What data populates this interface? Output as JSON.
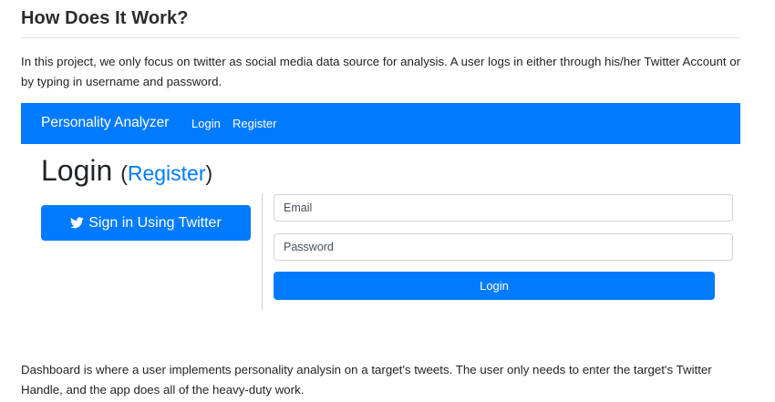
{
  "section": {
    "title": "How Does It Work?"
  },
  "intro": {
    "text": "In this project, we only focus on twitter as social media data source for analysis. A user logs in either through his/her Twitter Account or by typing in username and password."
  },
  "navbar": {
    "brand": "Personality Analyzer",
    "links": [
      "Login",
      "Register"
    ],
    "color": "#007bff"
  },
  "login_page": {
    "heading": "Login",
    "paren_open": "(",
    "register_link": "Register",
    "paren_close": ")",
    "twitter_button": {
      "label": "Sign in Using Twitter",
      "icon": "twitter-bird-icon"
    },
    "email": {
      "placeholder": "Email",
      "value": ""
    },
    "password": {
      "placeholder": "Password",
      "value": ""
    },
    "submit_label": "Login"
  },
  "dashboard": {
    "text": "Dashboard is where a user implements personality analysin on a target's tweets. The user only needs to enter the target's Twitter Handle, and the app does all of the heavy-duty work."
  }
}
